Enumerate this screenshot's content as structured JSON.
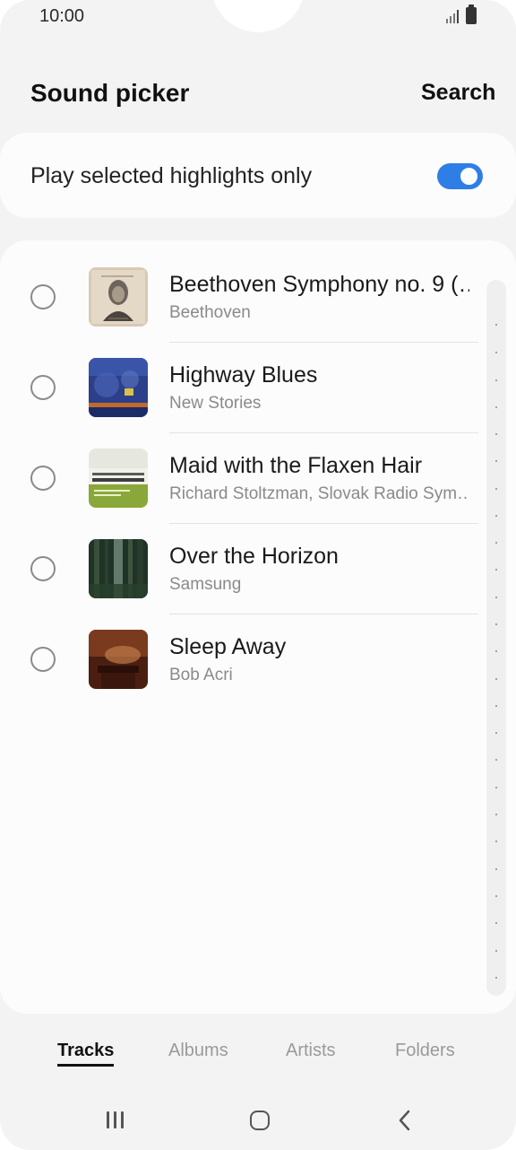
{
  "status_bar": {
    "time": "10:00"
  },
  "header": {
    "title": "Sound picker",
    "search_label": "Search"
  },
  "highlights": {
    "label": "Play selected highlights only",
    "enabled": true
  },
  "tracks": [
    {
      "title": "Beethoven Symphony no. 9 (…",
      "artist": "Beethoven",
      "art_icon": "beethoven-album-art"
    },
    {
      "title": "Highway Blues",
      "artist": "New Stories",
      "art_icon": "highway-blues-album-art"
    },
    {
      "title": "Maid with the Flaxen Hair",
      "artist": "Richard Stoltzman, Slovak Radio Sym…",
      "art_icon": "richard-stoltzman-album-art"
    },
    {
      "title": "Over the Horizon",
      "artist": "Samsung",
      "art_icon": "forest-album-art"
    },
    {
      "title": "Sleep Away",
      "artist": "Bob Acri",
      "art_icon": "piano-album-art"
    }
  ],
  "tabs": [
    {
      "label": "Tracks",
      "active": true
    },
    {
      "label": "Albums",
      "active": false
    },
    {
      "label": "Artists",
      "active": false
    },
    {
      "label": "Folders",
      "active": false
    }
  ],
  "colors": {
    "accent": "#2f7ee6",
    "background": "#f3f3f3",
    "card": "#fcfcfc"
  }
}
